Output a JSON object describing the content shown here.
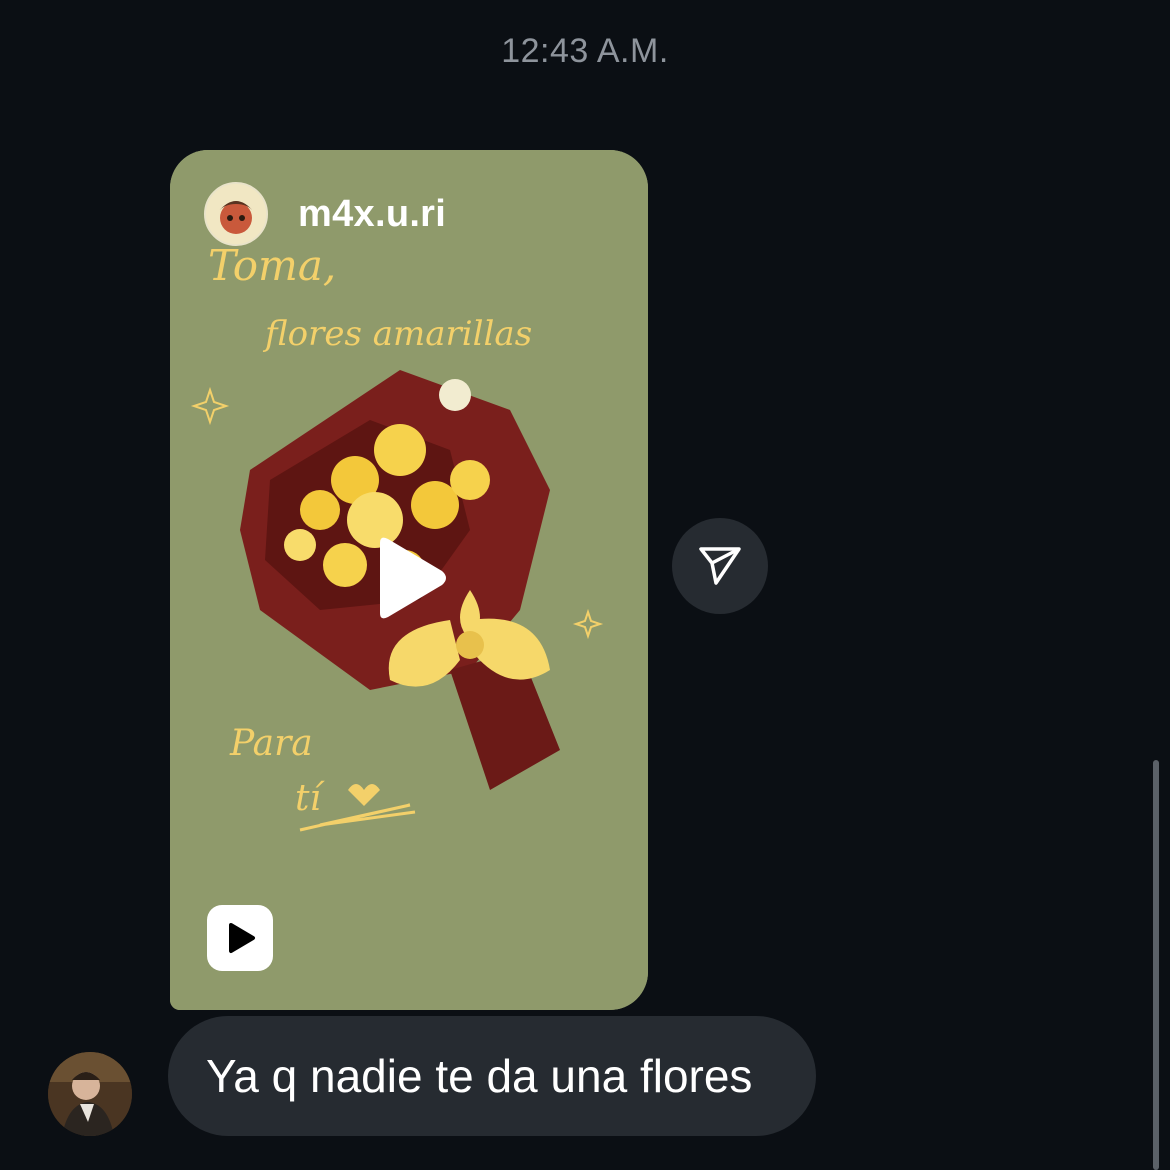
{
  "timestamp": "12:43 A.M.",
  "shared_reel": {
    "username": "m4x.u.ri",
    "handwritten_text": [
      "Toma,",
      "flores amarillas",
      "Para",
      "tí"
    ],
    "avatar_icon": "profile-avatar",
    "center_icon": "play-icon",
    "badge_icon": "reels-icon"
  },
  "share_button": {
    "icon": "send-icon"
  },
  "message": {
    "text": "Ya q nadie te da una flores",
    "sender_avatar": "profile-avatar"
  },
  "colors": {
    "background": "#0b0f14",
    "bubble": "#262b31",
    "reel_background": "#8f9a6b",
    "wrapper": "#7a1f1c",
    "flowers": "#f3c83a"
  }
}
